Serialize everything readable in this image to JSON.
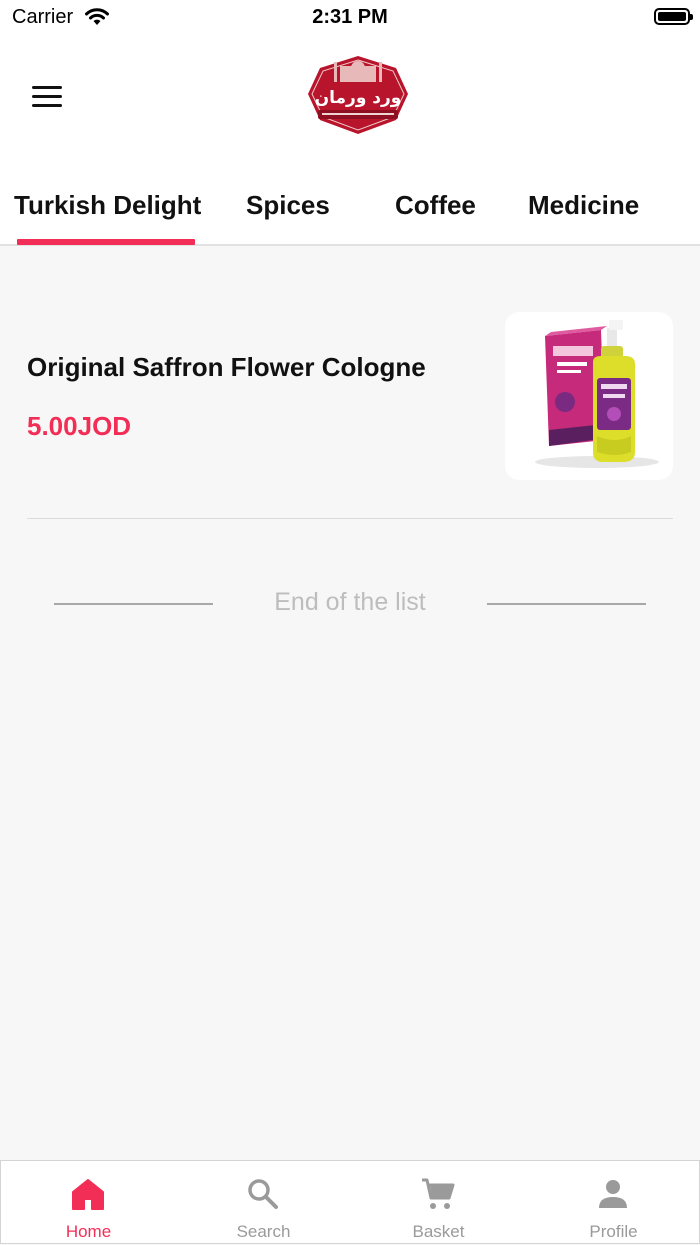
{
  "status_bar": {
    "carrier": "Carrier",
    "time": "2:31 PM"
  },
  "header": {
    "menu_icon": "hamburger-menu-icon",
    "logo_text": "ورد ورمان"
  },
  "tabs": [
    {
      "label": "Turkish Delight",
      "active": true
    },
    {
      "label": "Spices",
      "active": false
    },
    {
      "label": "Coffee",
      "active": false
    },
    {
      "label": "Medicine",
      "active": false
    }
  ],
  "products": [
    {
      "name": "Original Saffron Flower Cologne",
      "price": "5.00JOD"
    }
  ],
  "list_end_text": "End of the list",
  "bottom_nav": [
    {
      "label": "Home",
      "icon": "home-icon",
      "active": true
    },
    {
      "label": "Search",
      "icon": "search-icon",
      "active": false
    },
    {
      "label": "Basket",
      "icon": "cart-icon",
      "active": false
    },
    {
      "label": "Profile",
      "icon": "person-icon",
      "active": false
    }
  ],
  "colors": {
    "accent": "#f22e57",
    "background": "#f7f7f7",
    "logo_red": "#b8142c"
  }
}
